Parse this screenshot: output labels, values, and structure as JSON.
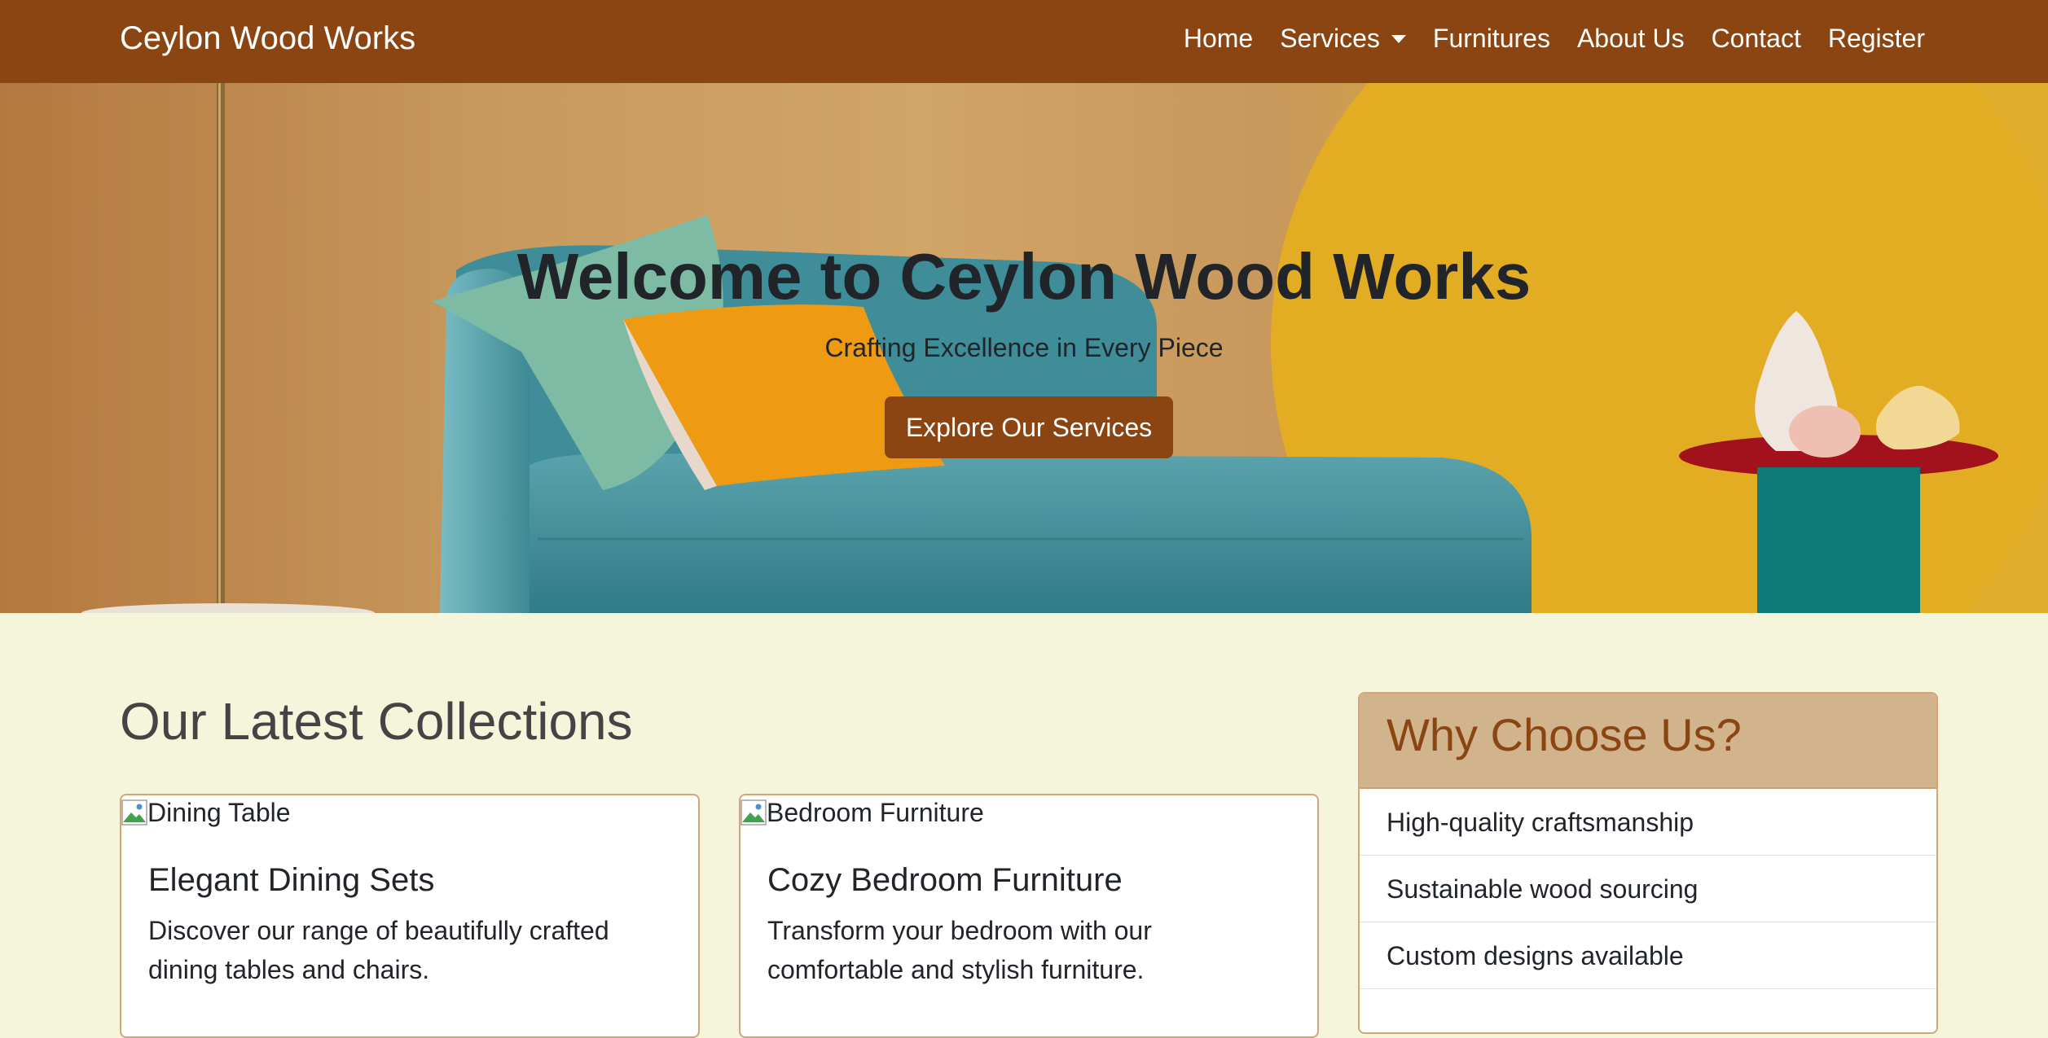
{
  "navbar": {
    "brand": "Ceylon Wood Works",
    "items": [
      {
        "label": "Home"
      },
      {
        "label": "Services"
      },
      {
        "label": "Furnitures"
      },
      {
        "label": "About Us"
      },
      {
        "label": "Contact"
      },
      {
        "label": "Register"
      }
    ]
  },
  "hero": {
    "title": "Welcome to Ceylon Wood Works",
    "subtitle": "Crafting Excellence in Every Piece",
    "cta_label": "Explore Our Services"
  },
  "collections": {
    "title": "Our Latest Collections",
    "cards": [
      {
        "image_alt": "Dining Table",
        "title": "Elegant Dining Sets",
        "text": "Discover our range of beautifully crafted dining tables and chairs."
      },
      {
        "image_alt": "Bedroom Furniture",
        "title": "Cozy Bedroom Furniture",
        "text": "Transform your bedroom with our comfortable and stylish furniture."
      }
    ]
  },
  "why_choose": {
    "title": "Why Choose Us?",
    "items": [
      {
        "label": "High-quality craftsmanship"
      },
      {
        "label": "Sustainable wood sourcing"
      },
      {
        "label": "Custom designs available"
      },
      {
        "label": ""
      }
    ]
  },
  "colors": {
    "navbar_bg": "#8b4513",
    "page_bg": "#f5f5dc",
    "accent": "#8b4513",
    "card_border": "#d2a679",
    "sidebar_header_bg": "#d2b48c"
  },
  "icons": {
    "dropdown": "chevron-down-icon",
    "broken_image": "broken-image-icon"
  }
}
